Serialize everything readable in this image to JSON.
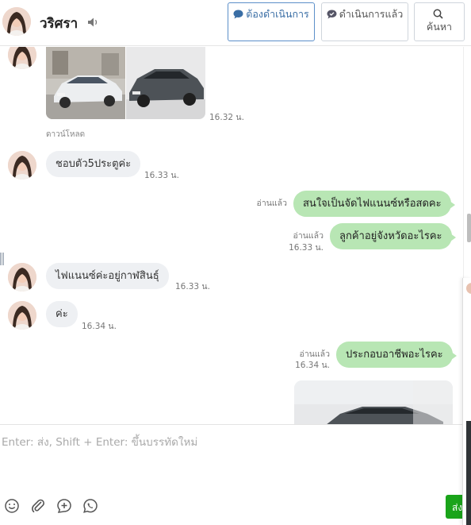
{
  "header": {
    "contact_name": "วริศรา",
    "buttons": {
      "todo_label": "ต้องดำเนินการ",
      "done_label": "ดำเนินการแล้ว",
      "search_label": "ค้นหา"
    },
    "icons": {
      "todo": "chat-bubble-icon",
      "done": "chat-bubble-check-icon",
      "search": "search-icon",
      "speaker": "speaker-icon"
    },
    "accent_color": "#5c8fc9"
  },
  "messages": [
    {
      "type": "image-group",
      "direction": "incoming",
      "count": 2,
      "time": "16.32 น.",
      "download_label": "ดาวน์โหลด"
    },
    {
      "type": "text",
      "direction": "incoming",
      "text": "ชอบตัว5ประตูค่ะ",
      "time": "16.33 น."
    },
    {
      "type": "text",
      "direction": "outgoing",
      "text": "สนใจเป็นจัดไฟแนนซ์หรือสดคะ",
      "read_label": "อ่านแล้ว",
      "time": ""
    },
    {
      "type": "text",
      "direction": "outgoing",
      "text": "ลูกค้าอยู่จังหวัดอะไรคะ",
      "read_label": "อ่านแล้ว",
      "time": "16.33 น."
    },
    {
      "type": "text",
      "direction": "incoming",
      "text": "ไฟแนนซ์ค่ะอยู่กาฬสินธุ์",
      "time": "16.33 น."
    },
    {
      "type": "text",
      "direction": "incoming",
      "text": "ค่ะ",
      "time": "16.34 น."
    },
    {
      "type": "text",
      "direction": "outgoing",
      "text": "ประกอบอาชีพอะไรคะ",
      "read_label": "อ่านแล้ว",
      "time": "16.34 น."
    },
    {
      "type": "image",
      "direction": "outgoing"
    }
  ],
  "composer": {
    "placeholder": "Enter: ส่ง, Shift + Enter: ขึ้นบรรทัดใหม่",
    "send_label": "ส่ง",
    "tools": [
      "smiley-icon",
      "paperclip-icon",
      "add-circle-icon",
      "whatsapp-icon"
    ]
  },
  "colors": {
    "incoming_bubble": "#eef0f3",
    "outgoing_bubble": "#b8e6b4",
    "send_button": "#1aa41a"
  }
}
